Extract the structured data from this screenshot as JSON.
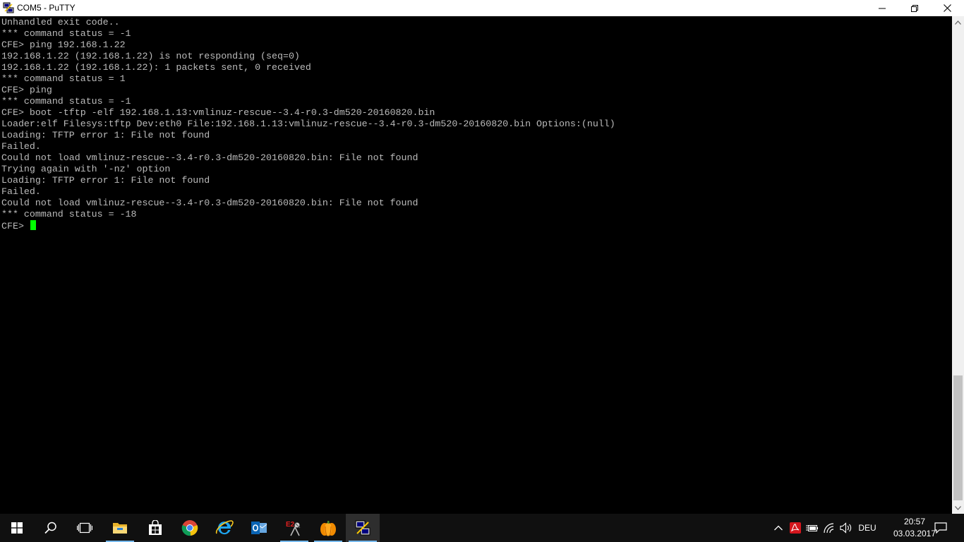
{
  "window": {
    "title": "COM5 - PuTTY",
    "icons": {
      "app": "putty-icon",
      "minimize": "minimize-icon",
      "maximize": "restore-icon",
      "close": "close-icon"
    }
  },
  "terminal": {
    "lines": [
      "Unhandled exit code..",
      "*** command status = -1",
      "CFE> ping 192.168.1.22",
      "192.168.1.22 (192.168.1.22) is not responding (seq=0)",
      "192.168.1.22 (192.168.1.22): 1 packets sent, 0 received",
      "*** command status = 1",
      "CFE> ping",
      "*** command status = -1",
      "CFE> boot -tftp -elf 192.168.1.13:vmlinuz-rescue--3.4-r0.3-dm520-20160820.bin",
      "Loader:elf Filesys:tftp Dev:eth0 File:192.168.1.13:vmlinuz-rescue--3.4-r0.3-dm520-20160820.bin Options:(null)",
      "Loading: TFTP error 1: File not found",
      "Failed.",
      "Could not load vmlinuz-rescue--3.4-r0.3-dm520-20160820.bin: File not found",
      "Trying again with '-nz' option",
      "Loading: TFTP error 1: File not found",
      "Failed.",
      "Could not load vmlinuz-rescue--3.4-r0.3-dm520-20160820.bin: File not found",
      "*** command status = -18"
    ],
    "prompt": "CFE> ",
    "colors": {
      "background": "#000000",
      "text": "#bbbbbb",
      "cursor": "#00ff00"
    }
  },
  "taskbar": {
    "apps": [
      "start-icon",
      "search-icon",
      "task-view-icon",
      "file-explorer-icon",
      "store-icon",
      "chrome-icon",
      "internet-explorer-icon",
      "outlook-icon",
      "e2-editor-icon",
      "pumpkin-icon",
      "putty-icon"
    ],
    "tray": {
      "icons": [
        "chevron-up-icon",
        "acrobat-icon",
        "battery-icon",
        "wifi-icon",
        "speaker-icon"
      ],
      "language": "DEU",
      "time": "20:57",
      "date": "03.03.2017",
      "notification_icon": "notification-icon"
    },
    "accent": "#76b9ed"
  }
}
